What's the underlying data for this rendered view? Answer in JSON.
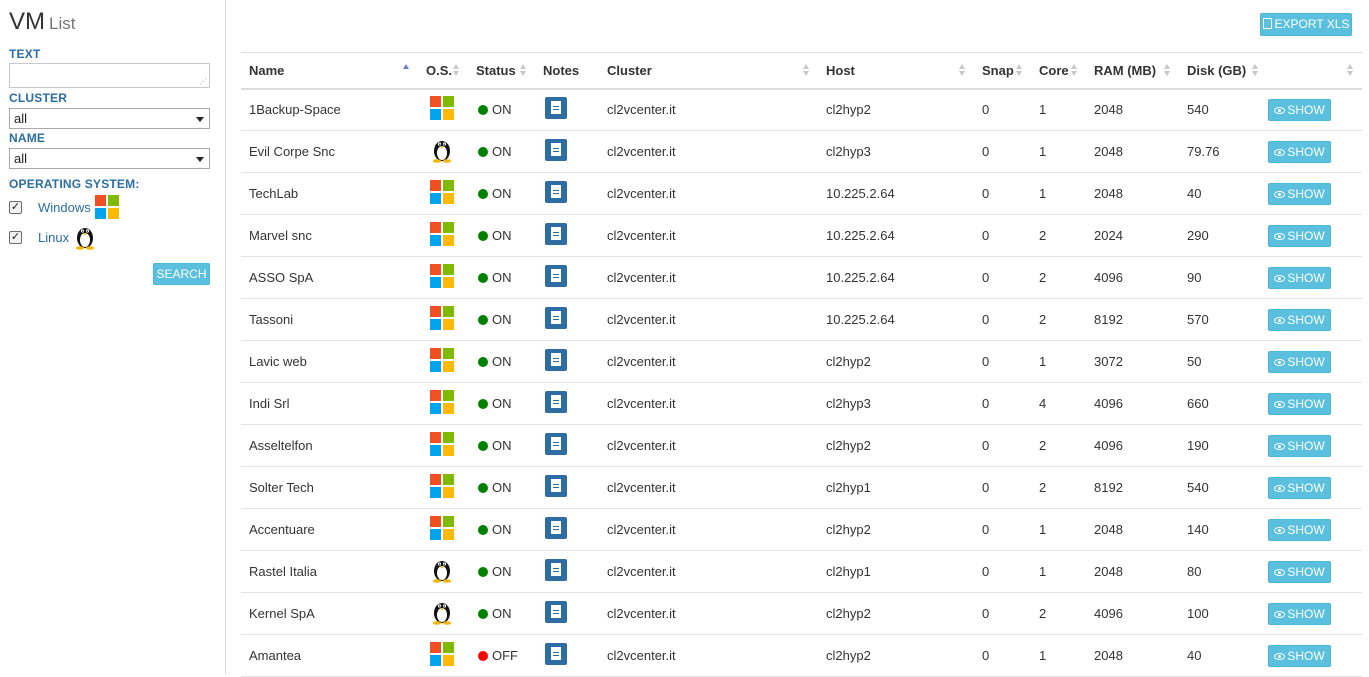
{
  "page": {
    "title": "VM",
    "subtitle": "List"
  },
  "filters": {
    "text_label": "TEXT",
    "text_value": "",
    "cluster_label": "CLUSTER",
    "cluster_value": "all",
    "name_label": "NAME",
    "name_value": "all",
    "os_label": "OPERATING SYSTEM:",
    "os_options": [
      {
        "label": "Windows",
        "checked": true,
        "icon": "windows-icon"
      },
      {
        "label": "Linux",
        "checked": true,
        "icon": "linux-icon"
      }
    ],
    "search_label": "SEARCH"
  },
  "toolbar": {
    "export_label": "EXPORT XLS"
  },
  "colors": {
    "on": "#008000",
    "off": "#ff0000",
    "accent": "#5bc0de",
    "link": "#2a6ea6"
  },
  "table": {
    "columns": [
      "Name",
      "O.S.",
      "Status",
      "Notes",
      "Cluster",
      "Host",
      "Snap",
      "Core",
      "RAM (MB)",
      "Disk (GB)",
      ""
    ],
    "sorted_column": "Name",
    "show_label": "SHOW",
    "rows": [
      {
        "name": "1Backup-Space",
        "os": "windows",
        "status": "ON",
        "cluster": "cl2vcenter.it",
        "host": "cl2hyp2",
        "snap": "0",
        "core": "1",
        "ram": "2048",
        "disk": "540"
      },
      {
        "name": "Evil Corpe Snc",
        "os": "linux",
        "status": "ON",
        "cluster": "cl2vcenter.it",
        "host": "cl2hyp3",
        "snap": "0",
        "core": "1",
        "ram": "2048",
        "disk": "79.76"
      },
      {
        "name": "TechLab",
        "os": "windows",
        "status": "ON",
        "cluster": "cl2vcenter.it",
        "host": "10.225.2.64",
        "snap": "0",
        "core": "1",
        "ram": "2048",
        "disk": "40"
      },
      {
        "name": "Marvel snc",
        "os": "windows",
        "status": "ON",
        "cluster": "cl2vcenter.it",
        "host": "10.225.2.64",
        "snap": "0",
        "core": "2",
        "ram": "2024",
        "disk": "290"
      },
      {
        "name": "ASSO SpA",
        "os": "windows",
        "status": "ON",
        "cluster": "cl2vcenter.it",
        "host": "10.225.2.64",
        "snap": "0",
        "core": "2",
        "ram": "4096",
        "disk": "90"
      },
      {
        "name": "Tassoni",
        "os": "windows",
        "status": "ON",
        "cluster": "cl2vcenter.it",
        "host": "10.225.2.64",
        "snap": "0",
        "core": "2",
        "ram": "8192",
        "disk": "570"
      },
      {
        "name": "Lavic web",
        "os": "windows",
        "status": "ON",
        "cluster": "cl2vcenter.it",
        "host": "cl2hyp2",
        "snap": "0",
        "core": "1",
        "ram": "3072",
        "disk": "50"
      },
      {
        "name": "Indi Srl",
        "os": "windows",
        "status": "ON",
        "cluster": "cl2vcenter.it",
        "host": "cl2hyp3",
        "snap": "0",
        "core": "4",
        "ram": "4096",
        "disk": "660"
      },
      {
        "name": "Asseltelfon",
        "os": "windows",
        "status": "ON",
        "cluster": "cl2vcenter.it",
        "host": "cl2hyp2",
        "snap": "0",
        "core": "2",
        "ram": "4096",
        "disk": "190"
      },
      {
        "name": "Solter Tech",
        "os": "windows",
        "status": "ON",
        "cluster": "cl2vcenter.it",
        "host": "cl2hyp1",
        "snap": "0",
        "core": "2",
        "ram": "8192",
        "disk": "540"
      },
      {
        "name": "Accentuare",
        "os": "windows",
        "status": "ON",
        "cluster": "cl2vcenter.it",
        "host": "cl2hyp2",
        "snap": "0",
        "core": "1",
        "ram": "2048",
        "disk": "140"
      },
      {
        "name": "Rastel Italia",
        "os": "linux",
        "status": "ON",
        "cluster": "cl2vcenter.it",
        "host": "cl2hyp1",
        "snap": "0",
        "core": "1",
        "ram": "2048",
        "disk": "80"
      },
      {
        "name": "Kernel SpA",
        "os": "linux",
        "status": "ON",
        "cluster": "cl2vcenter.it",
        "host": "cl2hyp2",
        "snap": "0",
        "core": "2",
        "ram": "4096",
        "disk": "100"
      },
      {
        "name": "Amantea",
        "os": "windows",
        "status": "OFF",
        "cluster": "cl2vcenter.it",
        "host": "cl2hyp2",
        "snap": "0",
        "core": "1",
        "ram": "2048",
        "disk": "40"
      }
    ]
  }
}
